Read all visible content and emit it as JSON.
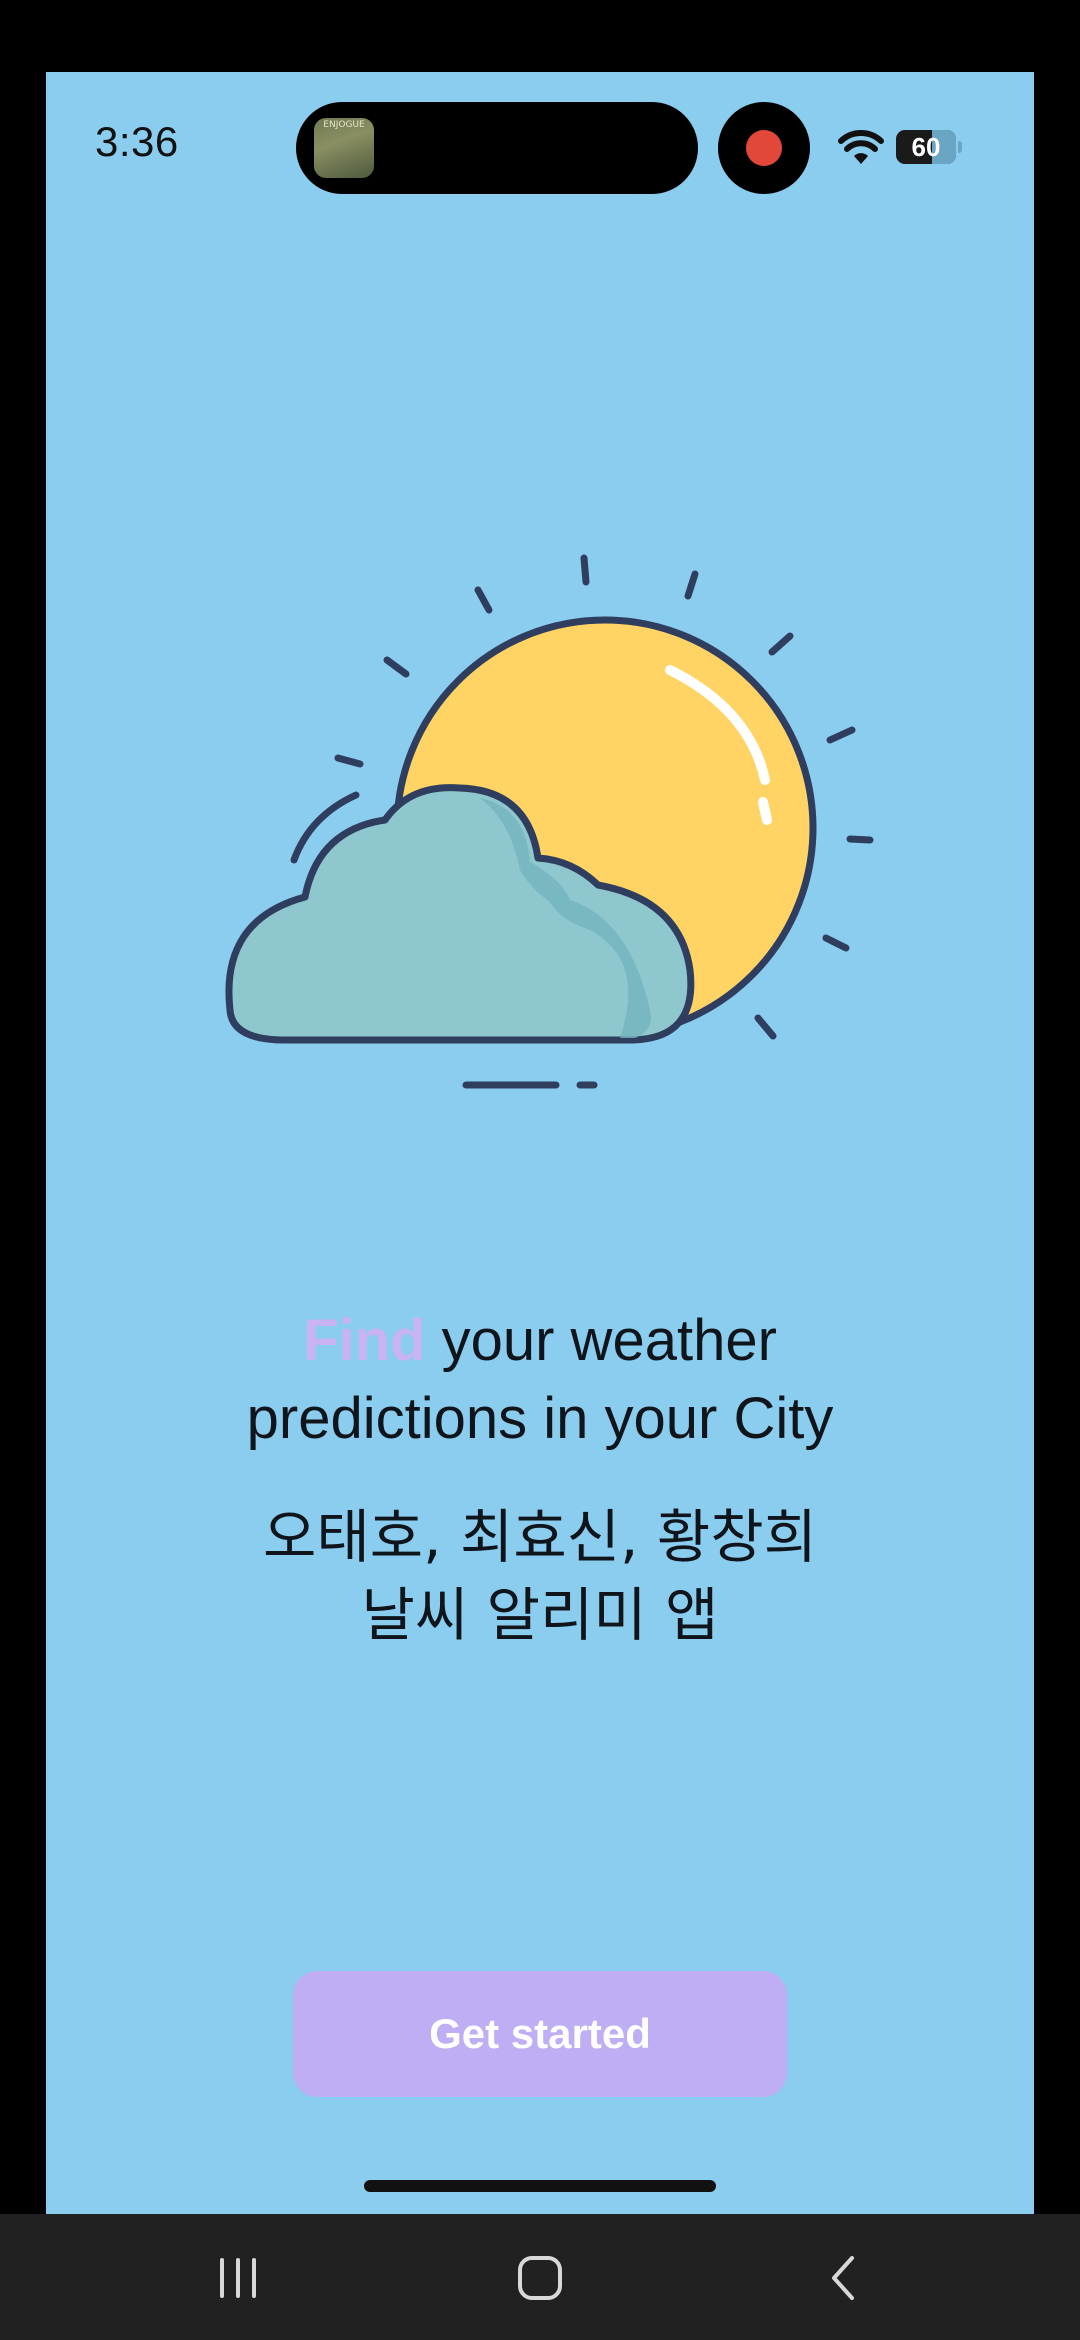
{
  "status_bar": {
    "time": "3:36",
    "island_thumb_label": "ENJOGUE",
    "battery": "60"
  },
  "onboarding": {
    "headline_accent": "Find",
    "headline_rest_line1": " your weather",
    "headline_line2": "predictions in your City",
    "subtitle_line1": "오태호, 최효신, 황창희",
    "subtitle_line2": "날씨 알리미 앱",
    "cta_label": "Get started"
  },
  "illustration": {
    "icon": "sun-behind-cloud-icon"
  },
  "colors": {
    "background": "#8bcdee",
    "accent": "#c9b3f2",
    "button": "#bfaef3",
    "sun": "#ffd465",
    "cloud": "#8fc7cf"
  },
  "nav_bar": {
    "recents_icon": "recents-icon",
    "home_icon": "home-icon",
    "back_icon": "back-icon"
  }
}
